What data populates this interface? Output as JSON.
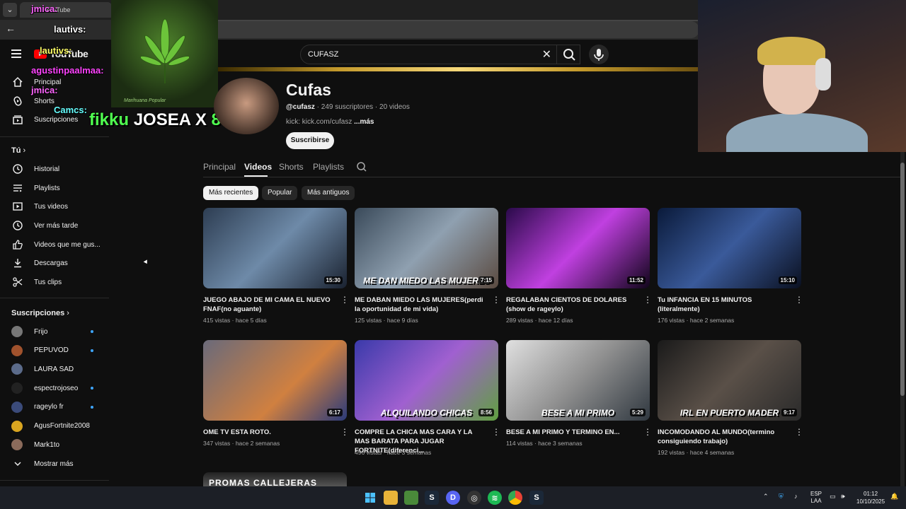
{
  "browser": {
    "tab_title": "YouTube",
    "tab_dropdown": "⌄"
  },
  "header": {
    "logo": "YouTube",
    "search_query": "CUFASZ"
  },
  "sidebar": {
    "main": [
      {
        "label": "Principal",
        "icon": "home-icon"
      },
      {
        "label": "Shorts",
        "icon": "shorts-icon"
      },
      {
        "label": "Suscripciones",
        "icon": "subscriptions-icon"
      }
    ],
    "you_title": "Tú",
    "you": [
      {
        "label": "Historial",
        "icon": "history-icon"
      },
      {
        "label": "Playlists",
        "icon": "playlists-icon"
      },
      {
        "label": "Tus videos",
        "icon": "my-videos-icon"
      },
      {
        "label": "Ver más tarde",
        "icon": "watch-later-icon"
      },
      {
        "label": "Videos que me gus...",
        "icon": "like-icon"
      },
      {
        "label": "Descargas",
        "icon": "download-icon"
      },
      {
        "label": "Tus clips",
        "icon": "scissors-icon"
      }
    ],
    "subs_title": "Suscripciones",
    "subs": [
      {
        "label": "Frijo",
        "color": "#777777",
        "live": true
      },
      {
        "label": "PEPUVOD",
        "color": "#a0522d",
        "live": true
      },
      {
        "label": "LAURA SAD",
        "color": "#5b6b8a",
        "live": false
      },
      {
        "label": "espectrojoseo",
        "color": "#222222",
        "live": true
      },
      {
        "label": "rageylo fr",
        "color": "#3b4b7a",
        "live": true
      },
      {
        "label": "AgusFortnite2008",
        "color": "#d9a520",
        "live": false
      },
      {
        "label": "Mark1to",
        "color": "#8b6b5b",
        "live": false
      }
    ],
    "show_more": "Mostrar más"
  },
  "overlay": {
    "chat": [
      {
        "name": "jmica:",
        "color": "#ff66ff"
      },
      {
        "name": "lautivs:",
        "color": "#ffffff"
      },
      {
        "name": "lautivs:",
        "color": "#ffff66"
      },
      {
        "name": "agustinpaalmaa:",
        "color": "#ff44ff"
      },
      {
        "name": "jmica:",
        "color": "#ff66ff"
      },
      {
        "name": "Camcs:",
        "color": "#66ffff"
      }
    ],
    "weed_caption": "Marihuana Popular",
    "big_name": "fikku",
    "big_text": "JOSEA X",
    "big_count": "8!"
  },
  "channel": {
    "name": "Cufas",
    "handle": "@cufasz",
    "stats": "· 249 suscriptores · 20 videos",
    "link": "kick: kick.com/cufasz",
    "more": "...más",
    "subscribe": "Suscribirse",
    "tabs": [
      "Principal",
      "Videos",
      "Shorts",
      "Playlists"
    ],
    "chips": [
      "Más recientes",
      "Popular",
      "Más antiguos"
    ]
  },
  "videos": [
    {
      "title": "JUEGO ABAJO DE MI CAMA EL NUEVO FNAF(no aguante)",
      "meta": "415 vistas · hace 5 días",
      "duration": "15:30",
      "caption": "",
      "bg": "linear-gradient(135deg,#2d3d52,#6e8aa8 50%,#1a2230)"
    },
    {
      "title": "ME DABAN MIEDO LAS MUJERES(perdi la oportunidad de mi vida)",
      "meta": "125 vistas · hace 9 días",
      "duration": "7:15",
      "caption": "ME DAN MIEDO LAS MUJERES",
      "bg": "linear-gradient(135deg,#3a4a5a,#8fa0b0 50%,#5a4a40)"
    },
    {
      "title": "REGALABAN CIENTOS DE DOLARES (show de rageylo)",
      "meta": "289 vistas · hace 12 días",
      "duration": "11:52",
      "caption": "",
      "bg": "linear-gradient(135deg,#2a0a4a,#c040e0 50%,#10051a)"
    },
    {
      "title": "Tu INFANCIA EN 15 MINUTOS (literalmente)",
      "meta": "176 vistas · hace 2 semanas",
      "duration": "15:10",
      "caption": "",
      "bg": "linear-gradient(135deg,#0a1a3a,#3a5a9a 50%,#0a1020)"
    },
    {
      "title": "OME TV ESTA ROTO.",
      "meta": "347 vistas · hace 2 semanas",
      "duration": "6:17",
      "caption": "",
      "bg": "linear-gradient(135deg,#6a6a7a,#d08040 60%,#2a3a7a)"
    },
    {
      "title": "COMPRE LA CHICA MAS CARA Y LA MAS BARATA PARA JUGAR FORTNITE(diferenci...",
      "meta": "496 vistas · hace 3 semanas",
      "duration": "8:56",
      "caption": "ALQUILANDO CHICAS",
      "bg": "linear-gradient(135deg,#3a3aaa,#a060d0 50%,#60a040)"
    },
    {
      "title": "BESE A MI PRIMO Y TERMINO EN...",
      "meta": "114 vistas · hace 3 semanas",
      "duration": "5:29",
      "caption": "BESE A MI PRIMO",
      "bg": "linear-gradient(135deg,#e0e0e0,#909090 50%,#303840)"
    },
    {
      "title": "INCOMODANDO AL MUNDO(termino consiguiendo trabajo)",
      "meta": "192 vistas · hace 4 semanas",
      "duration": "9:17",
      "caption": "IRL EN PUERTO MADER",
      "bg": "linear-gradient(135deg,#1a1a1a,#5a5048 50%,#2a2a2a)"
    }
  ],
  "peek_caption": "PROMAS CALLEJERAS",
  "taskbar": {
    "lang": "ESP",
    "lang2": "LAA",
    "time": "01:12",
    "date": "10/10/2025"
  }
}
